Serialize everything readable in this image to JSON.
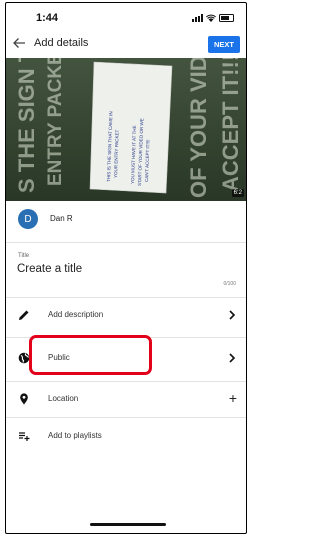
{
  "status_bar": {
    "time": "1:44"
  },
  "header": {
    "title": "Add details",
    "next_label": "NEXT"
  },
  "video": {
    "duration": "6:2",
    "sign_text_large_left": "S THE SIGN THAT",
    "sign_text_large_left_2": "ENTRY PACKET",
    "sign_text_large_right": "OF YOUR VIDE",
    "sign_text_large_right_2": "ACCEPT IT!!!!",
    "paper_text_1": "THIS IS THE SIGN THAT CAME IN",
    "paper_text_2": "YOUR ENTRY PACKET",
    "paper_text_3": "YOU MUST HAVE IT AT THE",
    "paper_text_4": "START OF YOUR VIDEO OR WE",
    "paper_text_5": "CAN'T ACCEPT IT!!!!"
  },
  "user": {
    "avatar_letter": "D",
    "name": "Dan R"
  },
  "title_field": {
    "label": "Title",
    "placeholder": "Create a title",
    "counter": "0/100"
  },
  "rows": {
    "description": {
      "label": "Add description",
      "icon": "pencil-icon"
    },
    "visibility": {
      "label": "Public",
      "icon": "globe-icon"
    },
    "location": {
      "label": "Location",
      "icon": "location-pin-icon"
    },
    "playlists": {
      "label": "Add to playlists",
      "icon": "playlist-add-icon"
    }
  },
  "colors": {
    "accent": "#1a73e8",
    "highlight": "#e3001b",
    "avatar": "#2a6fb3"
  }
}
